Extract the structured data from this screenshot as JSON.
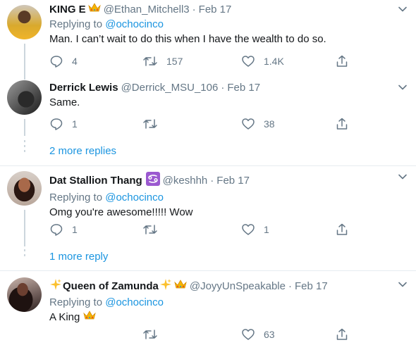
{
  "tweets": [
    {
      "name": "KING E",
      "handle": "@Ethan_Mitchell3",
      "date": "Feb 17",
      "replying_prefix": "Replying to",
      "replying_to": "@ochocinco",
      "text": "Man. I can’t wait to do this when I have the wealth to do so.",
      "replies": "4",
      "retweets": "157",
      "likes": "1.4K",
      "name_emoji_icon": "crown-icon"
    },
    {
      "name": "Derrick Lewis",
      "handle": "@Derrick_MSU_106",
      "date": "Feb 17",
      "text": "Same.",
      "replies": "1",
      "retweets": "",
      "likes": "38"
    },
    {
      "name": "Dat Stallion Thang",
      "handle": "@keshhh",
      "date": "Feb 17",
      "replying_prefix": "Replying to",
      "replying_to": "@ochocinco",
      "text": "Omg you're awesome!!!!! Wow",
      "replies": "1",
      "retweets": "",
      "likes": "1",
      "name_emoji_icon": "cancer-zodiac-icon"
    },
    {
      "name": "Queen of Zamunda",
      "handle": "@JoyyUnSpeakable",
      "date": "Feb 17",
      "replying_prefix": "Replying to",
      "replying_to": "@ochocinco",
      "text": "A King",
      "replies": "",
      "retweets": "",
      "likes": "63",
      "name_emoji_icons": [
        "sparkles-icon",
        "sparkles-icon",
        "crown-icon"
      ],
      "text_emoji_icon": "crown-icon"
    }
  ],
  "more_replies": [
    {
      "label": "2 more replies"
    },
    {
      "label": "1 more reply"
    }
  ],
  "colors": {
    "link": "#1b95e0",
    "muted": "#657786",
    "text": "#14171a",
    "divider": "#e6ecf0",
    "thread_line": "#ccd6dd"
  }
}
